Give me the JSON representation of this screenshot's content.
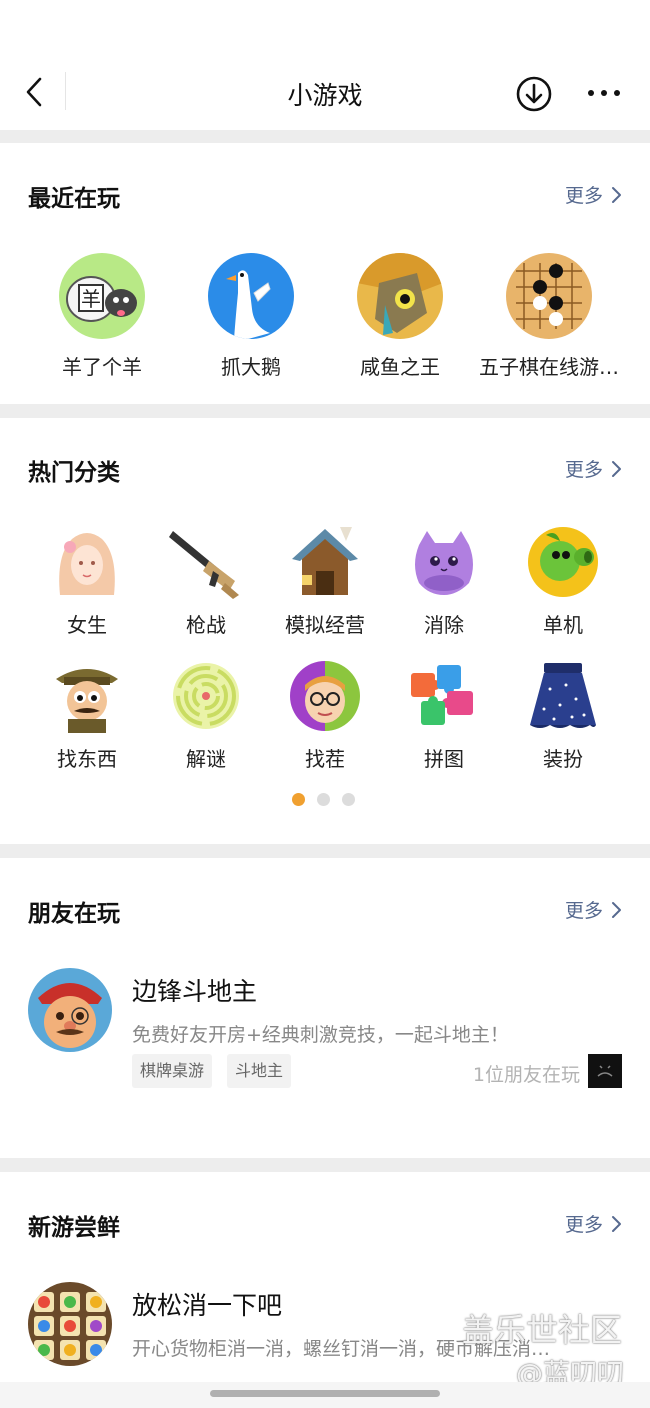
{
  "nav": {
    "title": "小游戏"
  },
  "recent": {
    "title": "最近在玩",
    "more": "更多",
    "items": [
      {
        "label": "羊了个羊",
        "icon": "sheep-game-icon"
      },
      {
        "label": "抓大鹅",
        "icon": "goose-game-icon"
      },
      {
        "label": "咸鱼之王",
        "icon": "salted-fish-king-icon"
      },
      {
        "label": "五子棋在线游…",
        "icon": "gomoku-icon"
      }
    ]
  },
  "categories": {
    "title": "热门分类",
    "more": "更多",
    "items": [
      {
        "label": "女生",
        "icon": "girl-icon"
      },
      {
        "label": "枪战",
        "icon": "rifle-icon"
      },
      {
        "label": "模拟经营",
        "icon": "house-icon"
      },
      {
        "label": "消除",
        "icon": "purple-cat-icon"
      },
      {
        "label": "单机",
        "icon": "peashooter-icon"
      },
      {
        "label": "找东西",
        "icon": "explorer-icon"
      },
      {
        "label": "解谜",
        "icon": "maze-icon"
      },
      {
        "label": "找茬",
        "icon": "face-compare-icon"
      },
      {
        "label": "拼图",
        "icon": "puzzle-icon"
      },
      {
        "label": "装扮",
        "icon": "skirt-icon"
      }
    ],
    "page_count": 3,
    "active_page": 1
  },
  "friends": {
    "title": "朋友在玩",
    "more": "更多",
    "game": {
      "name": "边锋斗地主",
      "desc": "免费好友开房+经典刺激竞技，一起斗地主！",
      "tags": [
        "棋牌桌游",
        "斗地主"
      ],
      "friends_playing": "1位朋友在玩"
    }
  },
  "newgames": {
    "title": "新游尝鲜",
    "more": "更多",
    "game": {
      "name": "放松消一下吧",
      "desc": "开心货物柜消一消，螺丝钉消一消，硬币解压消…"
    }
  },
  "watermark": {
    "line1": "盖乐世社区",
    "line2": "@蓝叨叨"
  },
  "colors": {
    "link": "#56698f",
    "dot_active": "#f0a030"
  }
}
